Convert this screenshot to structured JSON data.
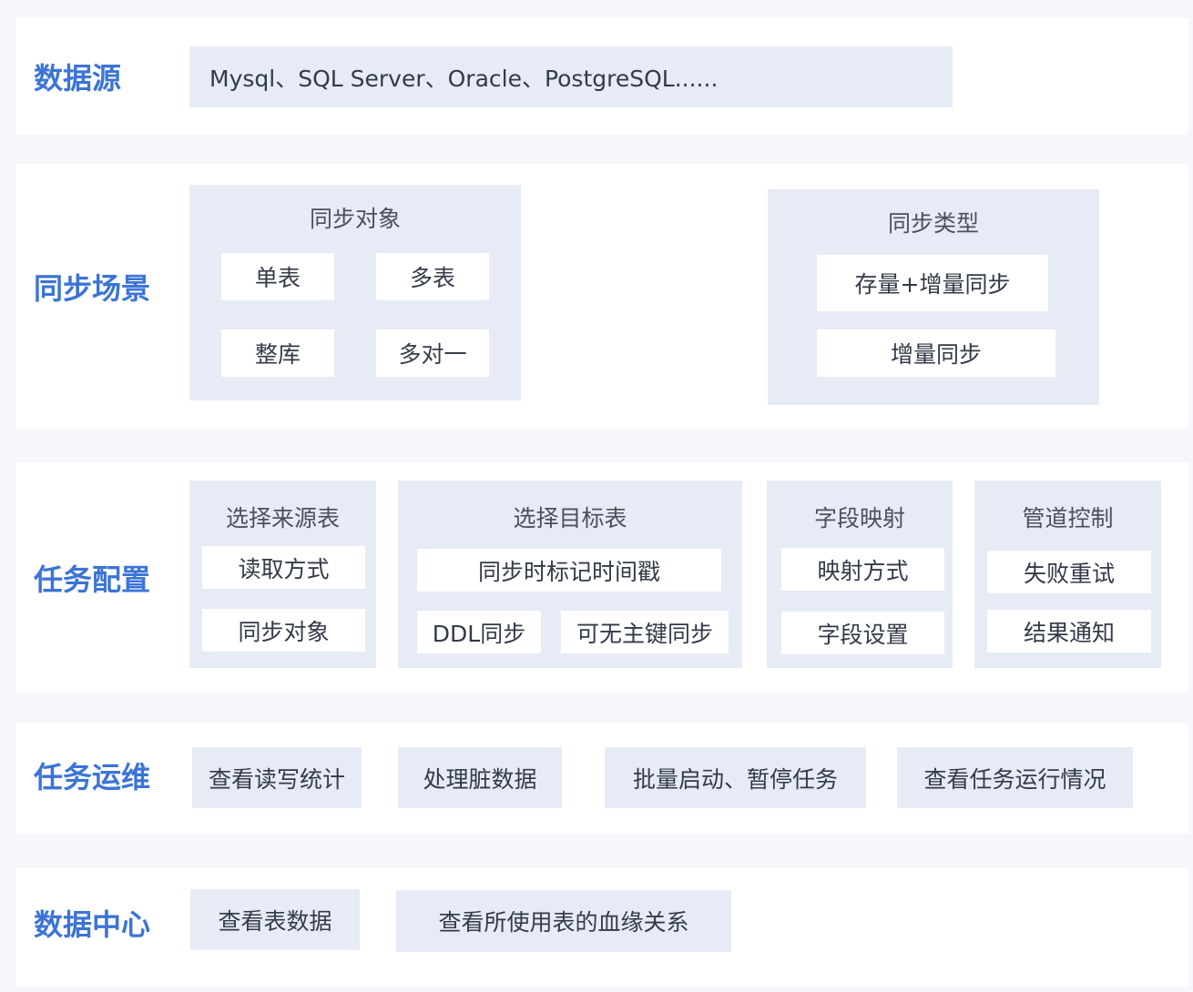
{
  "rows": {
    "datasource": {
      "label": "数据源",
      "text": "Mysql、SQL Server、Oracle、PostgreSQL......"
    },
    "sync_scene": {
      "label": "同步场景",
      "sync_object": {
        "title": "同步对象",
        "items": [
          "单表",
          "多表",
          "整库",
          "多对一"
        ]
      },
      "sync_type": {
        "title": "同步类型",
        "items": [
          "存量+增量同步",
          "增量同步"
        ]
      }
    },
    "task_config": {
      "label": "任务配置",
      "groups": [
        {
          "title": "选择来源表",
          "items": [
            "读取方式",
            "同步对象"
          ]
        },
        {
          "title": "选择目标表",
          "items": [
            "同步时标记时间戳",
            "DDL同步",
            "可无主键同步"
          ]
        },
        {
          "title": "字段映射",
          "items": [
            "映射方式",
            "字段设置"
          ]
        },
        {
          "title": "管道控制",
          "items": [
            "失败重试",
            "结果通知"
          ]
        }
      ]
    },
    "task_ops": {
      "label": "任务运维",
      "items": [
        "查看读写统计",
        "处理脏数据",
        "批量启动、暂停任务",
        "查看任务运行情况"
      ]
    },
    "data_center": {
      "label": "数据中心",
      "items": [
        "查看表数据",
        "查看所使用表的血缘关系"
      ]
    }
  }
}
